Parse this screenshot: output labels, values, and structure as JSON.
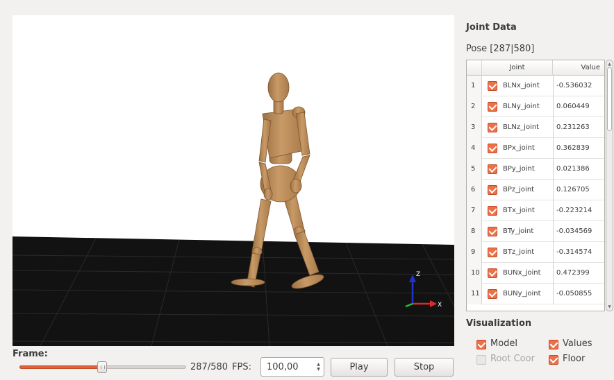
{
  "viewport": {
    "axes": {
      "x_label": "X",
      "z_label": "Z"
    },
    "colors": {
      "floor": "#121212",
      "grid": "#2a2a2a",
      "model": "#c1915e",
      "axis_x": "#e0282c",
      "axis_y": "#1fbf33",
      "axis_z": "#2233cc"
    }
  },
  "frame": {
    "label": "Frame:",
    "current": 287,
    "total": 580,
    "readout": "287/580",
    "fps_label": "FPS:",
    "fps_value": "100,00",
    "play_label": "Play",
    "stop_label": "Stop"
  },
  "joint_panel": {
    "title": "Joint Data",
    "pose": "Pose [287|580]",
    "columns": {
      "joint": "Joint",
      "value": "Value"
    },
    "rows": [
      {
        "index": "1",
        "name": "BLNx_joint",
        "value": "-0.536032",
        "checked": true
      },
      {
        "index": "2",
        "name": "BLNy_joint",
        "value": "0.060449",
        "checked": true
      },
      {
        "index": "3",
        "name": "BLNz_joint",
        "value": "0.231263",
        "checked": true
      },
      {
        "index": "4",
        "name": "BPx_joint",
        "value": "0.362839",
        "checked": true
      },
      {
        "index": "5",
        "name": "BPy_joint",
        "value": "0.021386",
        "checked": true
      },
      {
        "index": "6",
        "name": "BPz_joint",
        "value": "0.126705",
        "checked": true
      },
      {
        "index": "7",
        "name": "BTx_joint",
        "value": "-0.223214",
        "checked": true
      },
      {
        "index": "8",
        "name": "BTy_joint",
        "value": "-0.034569",
        "checked": true
      },
      {
        "index": "9",
        "name": "BTz_joint",
        "value": "-0.314574",
        "checked": true
      },
      {
        "index": "10",
        "name": "BUNx_joint",
        "value": "0.472399",
        "checked": true
      },
      {
        "index": "11",
        "name": "BUNy_joint",
        "value": "-0.050855",
        "checked": true
      }
    ]
  },
  "visualization": {
    "title": "Visualization",
    "model": {
      "label": "Model",
      "checked": true,
      "enabled": true
    },
    "values": {
      "label": "Values",
      "checked": true,
      "enabled": true
    },
    "root_coord": {
      "label": "Root Coor",
      "checked": false,
      "enabled": false
    },
    "floor": {
      "label": "Floor",
      "checked": true,
      "enabled": true
    }
  },
  "theme": {
    "accent": "#ee7046"
  }
}
